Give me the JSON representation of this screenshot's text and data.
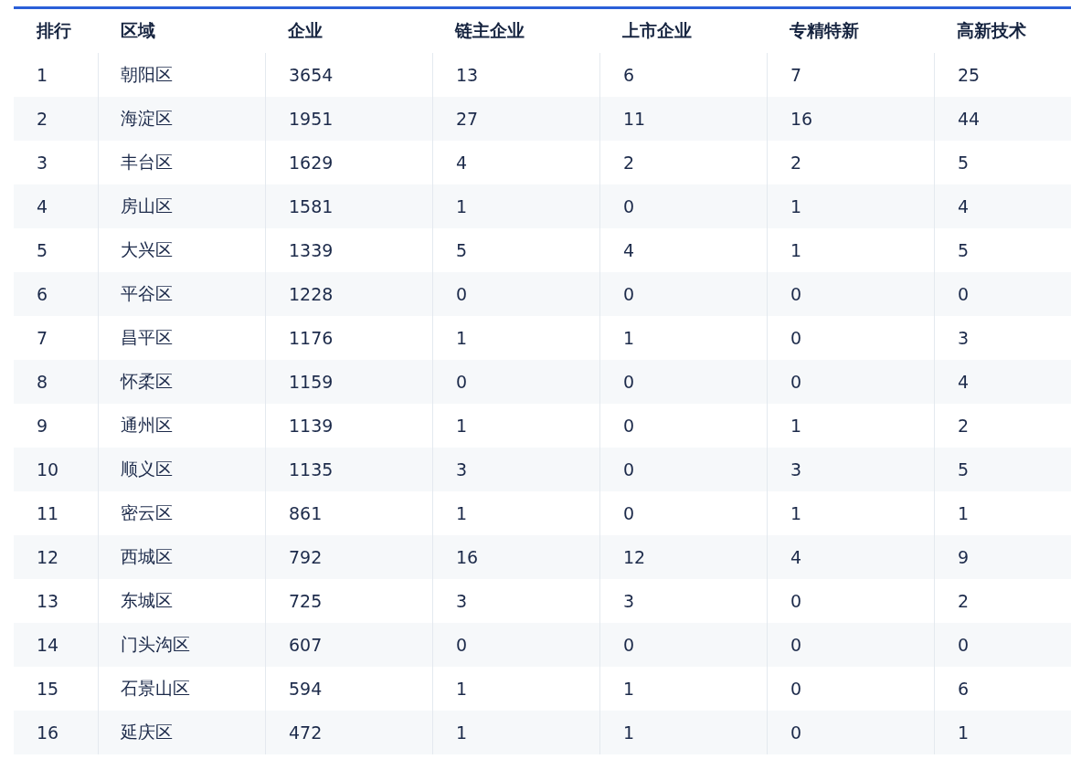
{
  "table": {
    "columns": [
      "排行",
      "区域",
      "企业",
      "链主企业",
      "上市企业",
      "专精特新",
      "高新技术"
    ],
    "rows": [
      [
        "1",
        "朝阳区",
        "3654",
        "13",
        "6",
        "7",
        "25"
      ],
      [
        "2",
        "海淀区",
        "1951",
        "27",
        "11",
        "16",
        "44"
      ],
      [
        "3",
        "丰台区",
        "1629",
        "4",
        "2",
        "2",
        "5"
      ],
      [
        "4",
        "房山区",
        "1581",
        "1",
        "0",
        "1",
        "4"
      ],
      [
        "5",
        "大兴区",
        "1339",
        "5",
        "4",
        "1",
        "5"
      ],
      [
        "6",
        "平谷区",
        "1228",
        "0",
        "0",
        "0",
        "0"
      ],
      [
        "7",
        "昌平区",
        "1176",
        "1",
        "1",
        "0",
        "3"
      ],
      [
        "8",
        "怀柔区",
        "1159",
        "0",
        "0",
        "0",
        "4"
      ],
      [
        "9",
        "通州区",
        "1139",
        "1",
        "0",
        "1",
        "2"
      ],
      [
        "10",
        "顺义区",
        "1135",
        "3",
        "0",
        "3",
        "5"
      ],
      [
        "11",
        "密云区",
        "861",
        "1",
        "0",
        "1",
        "1"
      ],
      [
        "12",
        "西城区",
        "792",
        "16",
        "12",
        "4",
        "9"
      ],
      [
        "13",
        "东城区",
        "725",
        "3",
        "3",
        "0",
        "2"
      ],
      [
        "14",
        "门头沟区",
        "607",
        "0",
        "0",
        "0",
        "0"
      ],
      [
        "15",
        "石景山区",
        "594",
        "1",
        "1",
        "0",
        "6"
      ],
      [
        "16",
        "延庆区",
        "472",
        "1",
        "1",
        "0",
        "1"
      ]
    ]
  }
}
